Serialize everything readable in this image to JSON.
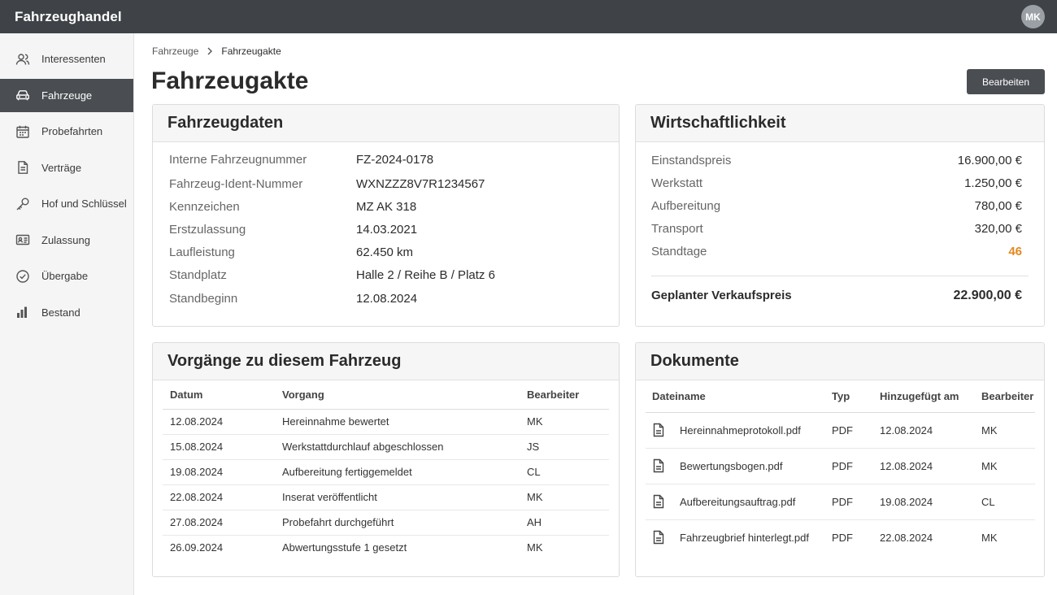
{
  "app": {
    "title": "Fahrzeughandel",
    "user_initials": "MK"
  },
  "sidebar": {
    "items": [
      {
        "label": "Interessenten",
        "icon": "users-icon",
        "active": false
      },
      {
        "label": "Fahrzeuge",
        "icon": "car-icon",
        "active": true
      },
      {
        "label": "Probefahrten",
        "icon": "calendar-icon",
        "active": false
      },
      {
        "label": "Verträge",
        "icon": "document-icon",
        "active": false
      },
      {
        "label": "Hof und Schlüssel",
        "icon": "key-icon",
        "active": false
      },
      {
        "label": "Zulassung",
        "icon": "id-card-icon",
        "active": false
      },
      {
        "label": "Übergabe",
        "icon": "check-circle-icon",
        "active": false
      },
      {
        "label": "Bestand",
        "icon": "bar-chart-icon",
        "active": false
      }
    ]
  },
  "breadcrumb": {
    "parent": "Fahrzeuge",
    "current": "Fahrzeugakte"
  },
  "page": {
    "title": "Fahrzeugakte",
    "edit_label": "Bearbeiten"
  },
  "vehicle": {
    "title": "Fahrzeugdaten",
    "rows": [
      {
        "label": "Interne Fahrzeugnummer",
        "value": "FZ-2024-0178"
      },
      {
        "label": "Fahrzeug-Ident-Nummer",
        "value": "WXNZZZ8V7R1234567"
      },
      {
        "label": "Kennzeichen",
        "value": "MZ AK 318"
      },
      {
        "label": "Erstzulassung",
        "value": "14.03.2021"
      },
      {
        "label": "Laufleistung",
        "value": "62.450 km"
      },
      {
        "label": "Standplatz",
        "value": "Halle 2 / Reihe B / Platz 6"
      },
      {
        "label": "Standbeginn",
        "value": "12.08.2024"
      }
    ]
  },
  "economics": {
    "title": "Wirtschaftlichkeit",
    "rows": [
      {
        "label": "Einstandspreis",
        "value": "16.900,00 €"
      },
      {
        "label": "Werkstatt",
        "value": "1.250,00 €"
      },
      {
        "label": "Aufbereitung",
        "value": "780,00 €"
      },
      {
        "label": "Transport",
        "value": "320,00 €"
      },
      {
        "label": "Standtage",
        "value": "46"
      }
    ],
    "warn_color": "#e08a1e",
    "total_label": "Geplanter Verkaufspreis",
    "total_value": "22.900,00 €"
  },
  "processes": {
    "title": "Vorgänge zu diesem Fahrzeug",
    "columns": [
      "Datum",
      "Vorgang",
      "Bearbeiter"
    ],
    "rows": [
      [
        "12.08.2024",
        "Hereinnahme bewertet",
        "MK"
      ],
      [
        "15.08.2024",
        "Werkstattdurchlauf abgeschlossen",
        "JS"
      ],
      [
        "19.08.2024",
        "Aufbereitung fertiggemeldet",
        "CL"
      ],
      [
        "22.08.2024",
        "Inserat veröffentlicht",
        "MK"
      ],
      [
        "27.08.2024",
        "Probefahrt durchgeführt",
        "AH"
      ],
      [
        "26.09.2024",
        "Abwertungsstufe 1 gesetzt",
        "MK"
      ]
    ]
  },
  "documents": {
    "title": "Dokumente",
    "columns": [
      "Dateiname",
      "Typ",
      "Hinzugefügt am",
      "Bearbeiter"
    ],
    "rows": [
      [
        "Hereinnahmeprotokoll.pdf",
        "PDF",
        "12.08.2024",
        "MK"
      ],
      [
        "Bewertungsbogen.pdf",
        "PDF",
        "12.08.2024",
        "MK"
      ],
      [
        "Aufbereitungsauftrag.pdf",
        "PDF",
        "19.08.2024",
        "CL"
      ],
      [
        "Fahrzeugbrief hinterlegt.pdf",
        "PDF",
        "22.08.2024",
        "MK"
      ]
    ]
  },
  "colors": {
    "topbar": "#3f4347",
    "active_nav": "#4a4e52",
    "accent_button": "#4a4e52"
  }
}
